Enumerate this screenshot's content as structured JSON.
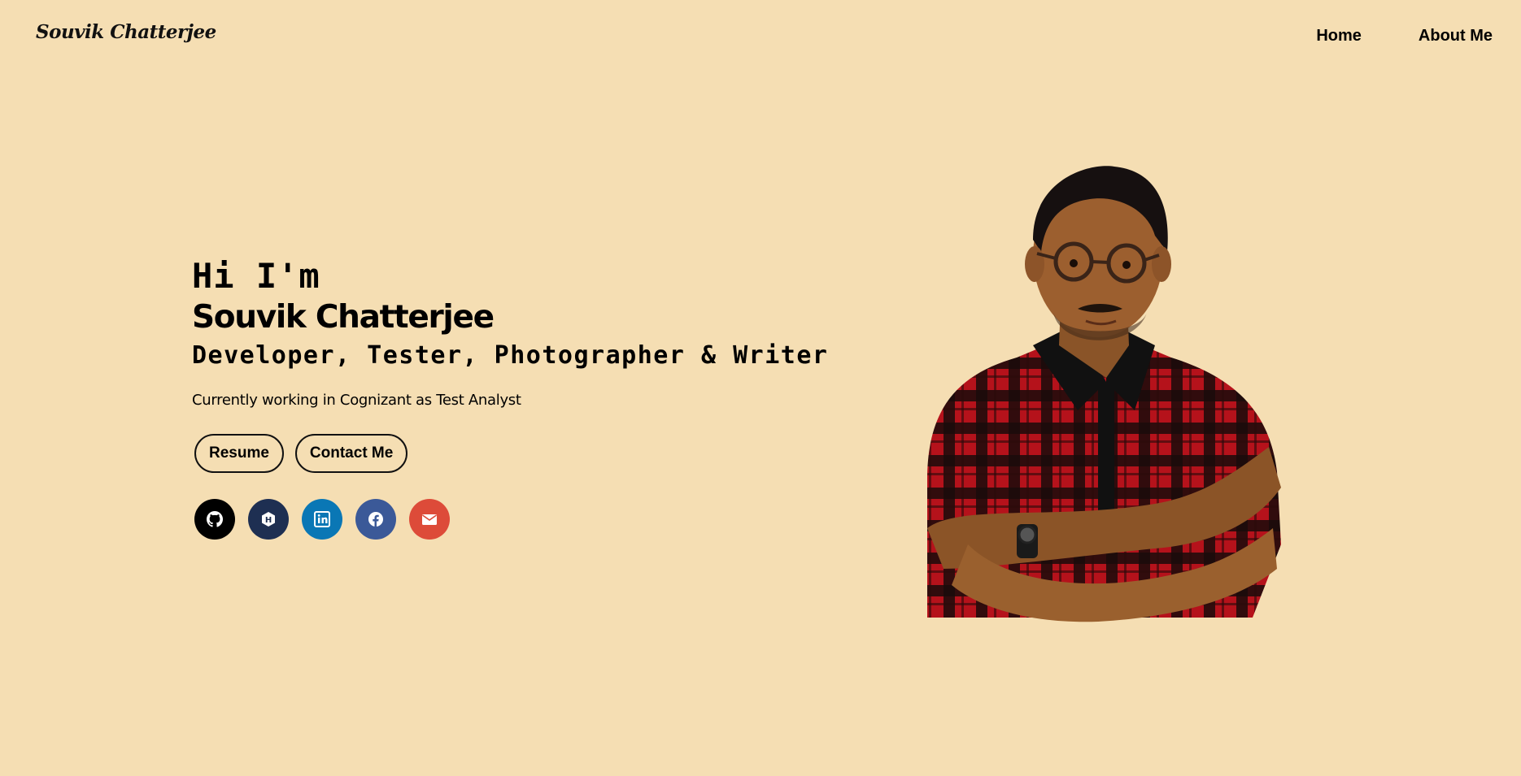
{
  "header": {
    "logo_text": "Souvik Chatterjee",
    "nav": [
      {
        "label": "Home"
      },
      {
        "label": "About Me"
      }
    ]
  },
  "hero": {
    "greeting": "Hi I'm",
    "name": "Souvik Chatterjee",
    "roles": "Developer, Tester, Photographer & Writer",
    "current_role": "Currently working in Cognizant as Test Analyst",
    "buttons": {
      "resume": "Resume",
      "contact": "Contact Me"
    },
    "socials": [
      {
        "name": "github-icon",
        "color": "#000000"
      },
      {
        "name": "hashnode-icon",
        "color": "#1e2f52"
      },
      {
        "name": "linkedin-icon",
        "color": "#0a77b5"
      },
      {
        "name": "facebook-icon",
        "color": "#3b5998"
      },
      {
        "name": "email-icon",
        "color": "#dd4b39"
      }
    ]
  },
  "colors": {
    "background": "#f5deb3",
    "text": "#000000"
  }
}
